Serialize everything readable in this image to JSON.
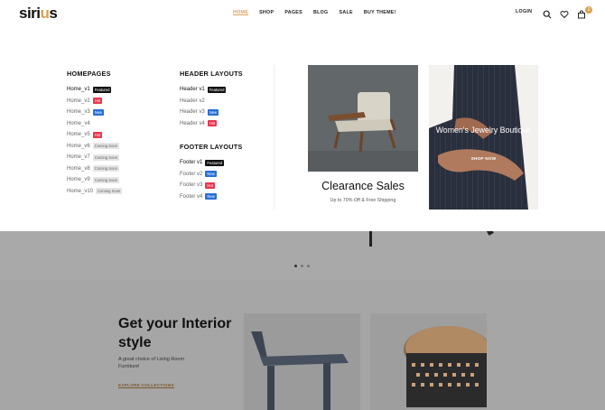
{
  "header": {
    "logo_text": "siri",
    "logo_accent": "u",
    "logo_end": "s",
    "nav": [
      "HOME",
      "SHOP",
      "PAGES",
      "BLOG",
      "SALE",
      "BUY THEME!"
    ],
    "active_nav": "HOME",
    "login": "LOGIN",
    "cart_count": "0",
    "icons": [
      "search-icon",
      "heart-icon",
      "cart-icon"
    ]
  },
  "mega_menu": {
    "homepages": {
      "title": "HOMEPAGES",
      "items": [
        {
          "label": "Home_v1",
          "tag": "Featured",
          "tag_type": "featured"
        },
        {
          "label": "Home_v2",
          "tag": "Hot",
          "tag_type": "hot"
        },
        {
          "label": "Home_v3",
          "tag": "New",
          "tag_type": "new"
        },
        {
          "label": "Home_v4",
          "tag": "",
          "tag_type": ""
        },
        {
          "label": "Home_v5",
          "tag": "Hot",
          "tag_type": "hot"
        },
        {
          "label": "Home_v6",
          "tag": "Coming Soon",
          "tag_type": "coming"
        },
        {
          "label": "Home_v7",
          "tag": "Coming Soon",
          "tag_type": "coming"
        },
        {
          "label": "Home_v8",
          "tag": "Coming Soon",
          "tag_type": "coming"
        },
        {
          "label": "Home_v9",
          "tag": "Coming Soon",
          "tag_type": "coming"
        },
        {
          "label": "Home_v10",
          "tag": "Coming Soon",
          "tag_type": "coming"
        }
      ]
    },
    "header_layouts": {
      "title": "HEADER LAYOUTS",
      "items": [
        {
          "label": "Header v1",
          "tag": "Featured",
          "tag_type": "featured"
        },
        {
          "label": "Header v2",
          "tag": "",
          "tag_type": ""
        },
        {
          "label": "Header v3",
          "tag": "New",
          "tag_type": "new"
        },
        {
          "label": "Header v4",
          "tag": "Hot",
          "tag_type": "hot"
        }
      ]
    },
    "footer_layouts": {
      "title": "FOOTER LAYOUTS",
      "items": [
        {
          "label": "Footer v1",
          "tag": "Featured",
          "tag_type": "featured"
        },
        {
          "label": "Footer v2",
          "tag": "New",
          "tag_type": "new"
        },
        {
          "label": "Footer v3",
          "tag": "Hot",
          "tag_type": "hot"
        },
        {
          "label": "Footer v4",
          "tag": "New",
          "tag_type": "new"
        }
      ]
    },
    "banner_clearance": {
      "title": "Clearance Sales",
      "subtitle": "Up to 70% Off & Free Shipping"
    },
    "banner_jewelry": {
      "title": "Women's Jewelry Boutique",
      "link": "SHOP NOW"
    }
  },
  "page": {
    "interior_title": "Get your Interior style",
    "interior_desc": "A great choice of Living Room Furniture!",
    "explore_link": "EXPLORE COLLECTIONS"
  },
  "colors": {
    "accent": "#d7a24a",
    "tag_featured": "#111111",
    "tag_hot": "#e8374f",
    "tag_new": "#2a6fd6",
    "tag_coming": "#e5e5e5"
  }
}
